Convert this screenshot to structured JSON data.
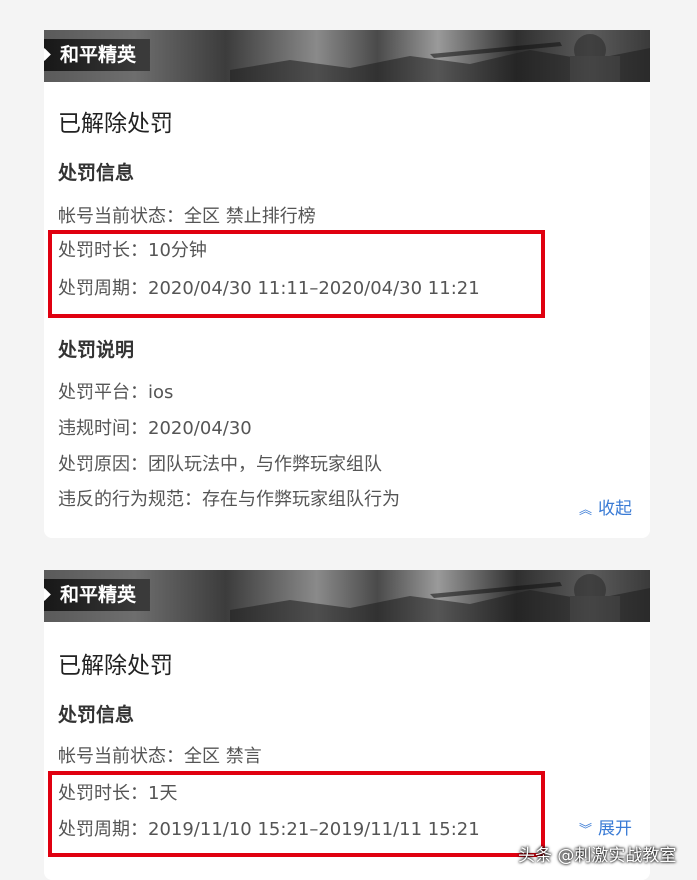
{
  "cards": [
    {
      "game": "和平精英",
      "status_title": "已解除处罚",
      "info_heading": "处罚信息",
      "account_state": "帐号当前状态：全区 禁止排行榜",
      "duration": "处罚时长：10分钟",
      "period": "处罚周期：2020/04/30 11:11–2020/04/30 11:21",
      "desc_heading": "处罚说明",
      "platform": "处罚平台：ios",
      "violation_time": "违规时间：2020/04/30",
      "reason": "处罚原因：团队玩法中，与作弊玩家组队",
      "rule": "违反的行为规范：存在与作弊玩家组队行为",
      "toggle": "收起",
      "toggle_icon": "chevron-up-double"
    },
    {
      "game": "和平精英",
      "status_title": "已解除处罚",
      "info_heading": "处罚信息",
      "account_state": "帐号当前状态：全区 禁言",
      "duration": "处罚时长：1天",
      "period": "处罚周期：2019/11/10 15:21–2019/11/11 15:21",
      "toggle": "展开",
      "toggle_icon": "chevron-down-double"
    }
  ],
  "watermark": "头条 @刺激实战教室",
  "colors": {
    "highlight": "#e00010",
    "link": "#3a7bd5",
    "background": "#f4f4f4"
  }
}
